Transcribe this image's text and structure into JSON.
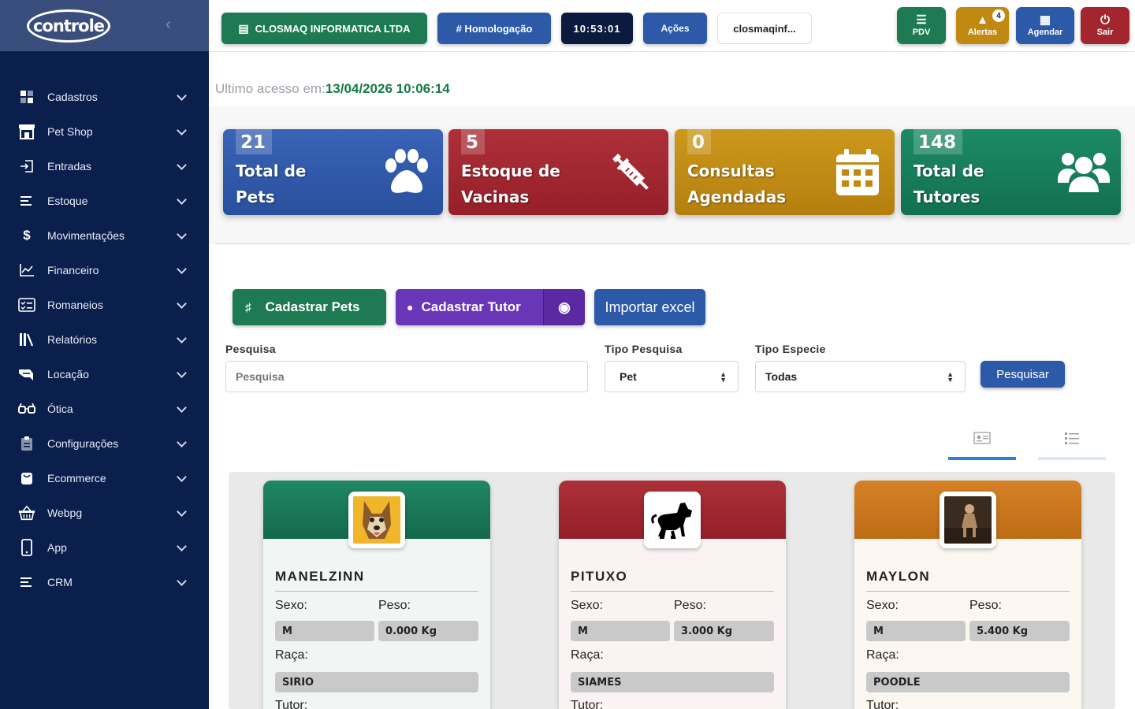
{
  "sidebar": {
    "logo_text": "controle",
    "items": [
      {
        "label": "Cadastros",
        "icon": "grid-icon"
      },
      {
        "label": "Pet Shop",
        "icon": "store-icon"
      },
      {
        "label": "Entradas",
        "icon": "login-icon"
      },
      {
        "label": "Estoque",
        "icon": "lines-icon"
      },
      {
        "label": "Movimentações",
        "icon": "dollar-icon"
      },
      {
        "label": "Financeiro",
        "icon": "chart-icon"
      },
      {
        "label": "Romaneios",
        "icon": "checklist-icon"
      },
      {
        "label": "Relatórios",
        "icon": "books-icon"
      },
      {
        "label": "Locação",
        "icon": "handshake-icon"
      },
      {
        "label": "Ótica",
        "icon": "glasses-icon"
      },
      {
        "label": "Configurações",
        "icon": "clipboard-icon"
      },
      {
        "label": "Ecommerce",
        "icon": "bag-icon"
      },
      {
        "label": "Webpg",
        "icon": "basket-icon"
      },
      {
        "label": "App",
        "icon": "phone-icon"
      },
      {
        "label": "CRM",
        "icon": "lines-icon"
      }
    ]
  },
  "topbar": {
    "company": "CLOSMAQ INFORMATICA LTDA",
    "env": "# Homologação",
    "clock": "10:53:01",
    "actions": "Ações",
    "user": "closmaqinf...",
    "pdv": "PDV",
    "alerts": "Alertas",
    "alerts_count": "4",
    "schedule": "Agendar",
    "logout": "Sair"
  },
  "last_access": {
    "label": "Ultimo acesso em:",
    "value": "13/04/2026 10:06:14"
  },
  "stats": [
    {
      "num": "21",
      "line1": "Total de",
      "line2": "Pets",
      "icon": "paw-icon",
      "color": "#2f56a6"
    },
    {
      "num": "5",
      "line1": "Estoque de",
      "line2": "Vacinas",
      "icon": "syringe-icon",
      "color": "#a3262f"
    },
    {
      "num": "0",
      "line1": "Consultas",
      "line2": "Agendadas",
      "icon": "calendar-icon",
      "color": "#c08a12"
    },
    {
      "num": "148",
      "line1": "Total de",
      "line2": "Tutores",
      "icon": "users-icon",
      "color": "#167a5a"
    }
  ],
  "actions": {
    "add_pet": "Cadastrar Pets",
    "add_tutor": "Cadastrar Tutor",
    "import_excel": "Importar excel"
  },
  "filters": {
    "search_label": "Pesquisa",
    "search_placeholder": "Pesquisa",
    "type_label": "Tipo Pesquisa",
    "type_value": "Pet",
    "species_label": "Tipo Especie",
    "species_value": "Todas",
    "search_button": "Pesquisar"
  },
  "pets": [
    {
      "name": "MANELZINN",
      "sex_label": "Sexo:",
      "sex": "M",
      "weight_label": "Peso:",
      "weight": "0.000 Kg",
      "breed_label": "Raça:",
      "breed": "SIRIO",
      "tutor_label": "Tutor:",
      "color": "#1d7a5e"
    },
    {
      "name": "PITUXO",
      "sex_label": "Sexo:",
      "sex": "M",
      "weight_label": "Peso:",
      "weight": "3.000 Kg",
      "breed_label": "Raça:",
      "breed": "SIAMES",
      "tutor_label": "Tutor:",
      "color": "#a3262f"
    },
    {
      "name": "MAYLON",
      "sex_label": "Sexo:",
      "sex": "M",
      "weight_label": "Peso:",
      "weight": "5.400 Kg",
      "breed_label": "Raça:",
      "breed": "POODLE",
      "tutor_label": "Tutor:",
      "color": "#cf7a1f"
    }
  ]
}
